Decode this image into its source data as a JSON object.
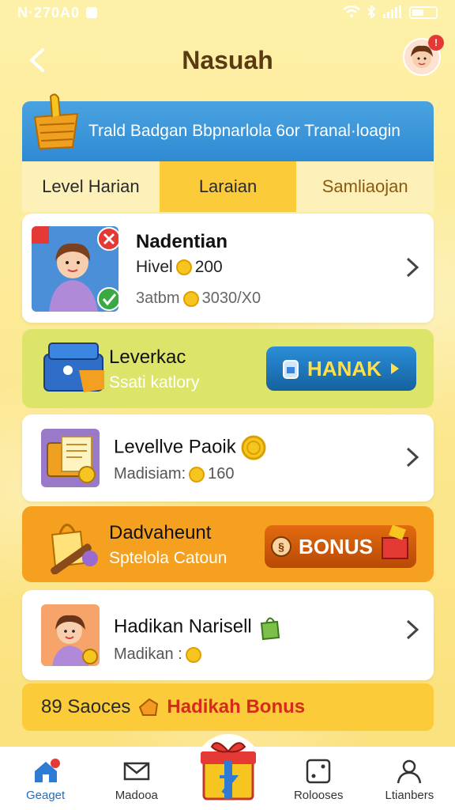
{
  "status_bar": {
    "left_text": "N·270A0"
  },
  "header": {
    "title": "Nasuah"
  },
  "banner": {
    "text": "Trald Badgan Bbpnarlola 6or Tranal·loagin"
  },
  "tabs": [
    {
      "label": "Level Harian",
      "active": false
    },
    {
      "label": "Laraian",
      "active": true
    },
    {
      "label": "Samliaojan",
      "active": false
    }
  ],
  "cards": {
    "card1": {
      "title": "Nadentian",
      "line2_label": "Hivel",
      "line2_value": "200",
      "line3_label": "3atbm",
      "line3_value": "3030/X0"
    },
    "card2": {
      "title": "Leverkac",
      "subtitle": "Ssati katlory",
      "button_label": "HANAK"
    },
    "card3": {
      "title": "Levellve Paoik",
      "line2_label": "Madisiam:",
      "line2_value": "160"
    },
    "card4": {
      "title": "Dadvaheunt",
      "subtitle": "Sptelola Catoun",
      "button_label": "BONUS"
    },
    "card5": {
      "title": "Hadikan Narisell",
      "line2_label": "Madikan :"
    }
  },
  "footer_strip": {
    "left_text": "89 Saoces",
    "bonus_text": "Hadikah Bonus"
  },
  "bottom_nav": [
    {
      "label": "Geaget",
      "icon": "home-icon",
      "active": true
    },
    {
      "label": "Madooa",
      "icon": "mail-icon",
      "active": false
    },
    {
      "label": "Rolooses",
      "icon": "dice-icon",
      "active": false
    },
    {
      "label": "Ltianbers",
      "icon": "profile-icon",
      "active": false
    }
  ],
  "colors": {
    "accent": "#fccb3a",
    "banner_blue": "#2f8ad3",
    "bonus_red": "#d62b1a"
  }
}
